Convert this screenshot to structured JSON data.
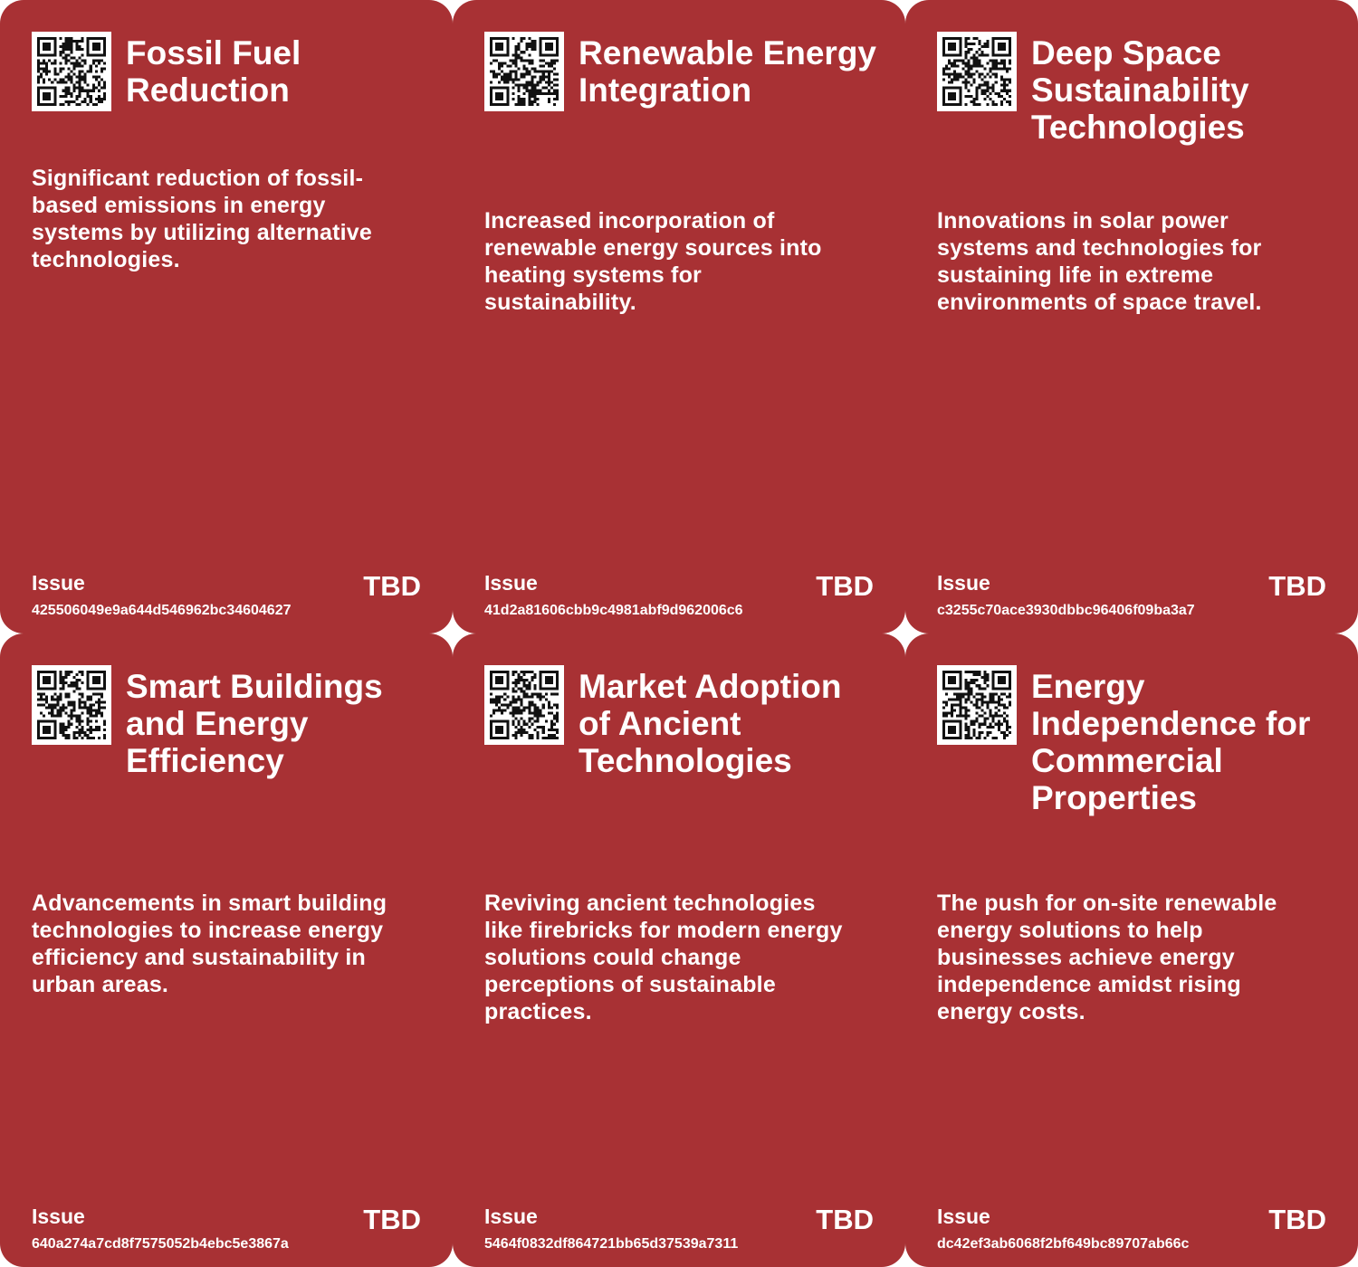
{
  "cards": [
    {
      "title": "Fossil Fuel Reduction",
      "description": "Significant reduction of fossil-based emissions in energy systems by utilizing alternative technologies.",
      "issue_label": "Issue",
      "issue_id": "425506049e9a644d546962bc34604627",
      "status": "TBD"
    },
    {
      "title": "Renewable Energy Integration",
      "description": "Increased incorporation of renewable energy sources into heating systems for sustainability.",
      "issue_label": "Issue",
      "issue_id": "41d2a81606cbb9c4981abf9d962006c6",
      "status": "TBD"
    },
    {
      "title": "Deep Space Sustainability Technologies",
      "description": "Innovations in solar power systems and technologies for sustaining life in extreme environments of space travel.",
      "issue_label": "Issue",
      "issue_id": "c3255c70ace3930dbbc96406f09ba3a7",
      "status": "TBD"
    },
    {
      "title": "Smart Buildings and Energy Efficiency",
      "description": "Advancements in smart building technologies to increase energy efficiency and sustainability in urban areas.",
      "issue_label": "Issue",
      "issue_id": "640a274a7cd8f7575052b4ebc5e3867a",
      "status": "TBD"
    },
    {
      "title": "Market Adoption of Ancient Technologies",
      "description": "Reviving ancient technologies like firebricks for modern energy solutions could change perceptions of sustainable practices.",
      "issue_label": "Issue",
      "issue_id": "5464f0832df864721bb65d37539a7311",
      "status": "TBD"
    },
    {
      "title": "Energy Independence for Commercial Properties",
      "description": "The push for on-site renewable energy solutions to help businesses achieve energy independence amidst rising energy costs.",
      "issue_label": "Issue",
      "issue_id": "dc42ef3ab6068f2bf649bc89707ab66c",
      "status": "TBD"
    }
  ],
  "colors": {
    "card_background": "#a83134",
    "text": "#ffffff",
    "page_background": "#ffffff"
  },
  "icons": {
    "qr": "qr-code-icon"
  }
}
